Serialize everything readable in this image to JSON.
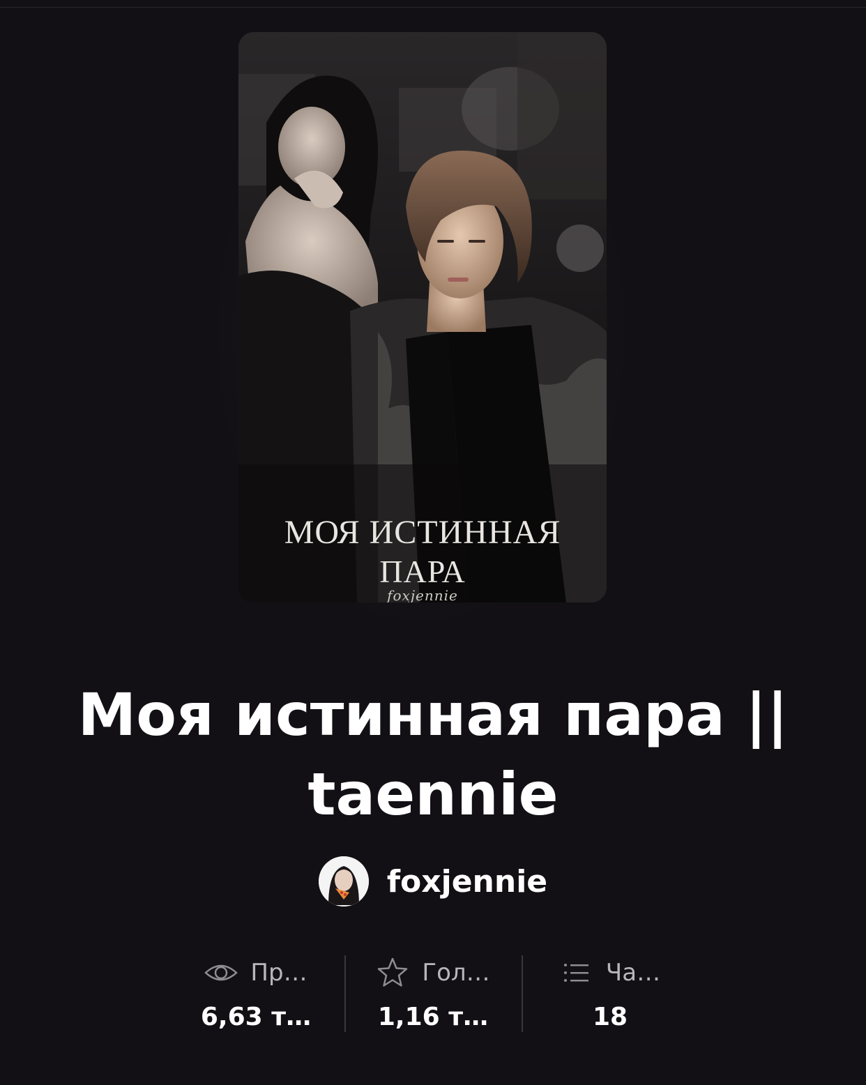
{
  "story": {
    "title": "Моя истинная пара || taennie",
    "cover": {
      "title_line1": "МОЯ ИСТИННАЯ",
      "title_line2": "ПАРА",
      "author_signature": "foxjennie"
    },
    "author": {
      "name": "foxjennie"
    }
  },
  "stats": [
    {
      "icon": "eye-icon",
      "label": "Пр…",
      "value": "6,63 т…"
    },
    {
      "icon": "star-icon",
      "label": "Гол…",
      "value": "1,16 т…"
    },
    {
      "icon": "list-icon",
      "label": "Ча…",
      "value": "18"
    }
  ],
  "colors": {
    "background": "#121014",
    "text_primary": "#ffffff",
    "text_secondary": "#b9b6bb",
    "divider": "#3a373d"
  }
}
